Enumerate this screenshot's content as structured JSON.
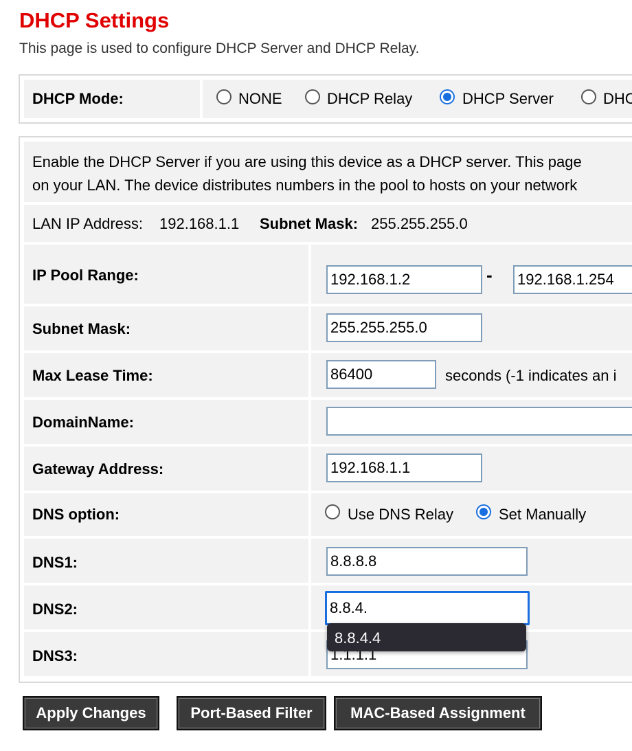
{
  "page": {
    "title": "DHCP Settings",
    "subtitle": "This page is used to configure DHCP Server and DHCP Relay."
  },
  "mode": {
    "label": "DHCP Mode:",
    "options": [
      "NONE",
      "DHCP Relay",
      "DHCP Server",
      "DHC"
    ],
    "selected": "DHCP Server"
  },
  "description": {
    "line1": "Enable the DHCP Server if you are using this device as a DHCP server. This page",
    "line2": "on your LAN. The device distributes numbers in the pool to hosts on your network"
  },
  "lan_info": {
    "ip_label": "LAN IP Address:",
    "ip_value": "192.168.1.1",
    "mask_label": "Subnet Mask:",
    "mask_value": "255.255.255.0"
  },
  "fields": {
    "ip_pool": {
      "label": "IP Pool Range:",
      "start": "192.168.1.2",
      "separator": "-",
      "end": "192.168.1.254"
    },
    "subnet_mask": {
      "label": "Subnet Mask:",
      "value": "255.255.255.0"
    },
    "max_lease": {
      "label": "Max Lease Time:",
      "value": "86400",
      "note": "seconds (-1 indicates an i"
    },
    "domain_name": {
      "label": "DomainName:",
      "value": ""
    },
    "gateway": {
      "label": "Gateway Address:",
      "value": "192.168.1.1"
    },
    "dns_option": {
      "label": "DNS option:",
      "options": [
        "Use DNS Relay",
        "Set Manually"
      ],
      "selected": "Set Manually"
    },
    "dns1": {
      "label": "DNS1:",
      "value": "8.8.8.8"
    },
    "dns2": {
      "label": "DNS2:",
      "value": "8.8.4."
    },
    "dns3": {
      "label": "DNS3:",
      "value": "1.1.1.1"
    }
  },
  "autocomplete": {
    "suggestion": "8.8.4.4"
  },
  "buttons": {
    "apply": "Apply Changes",
    "port_filter": "Port-Based Filter",
    "mac_assignment": "MAC-Based Assignment"
  },
  "colors": {
    "title": "#e00000",
    "accent": "#1a6fe0",
    "button_bg": "#3a3a3a"
  }
}
